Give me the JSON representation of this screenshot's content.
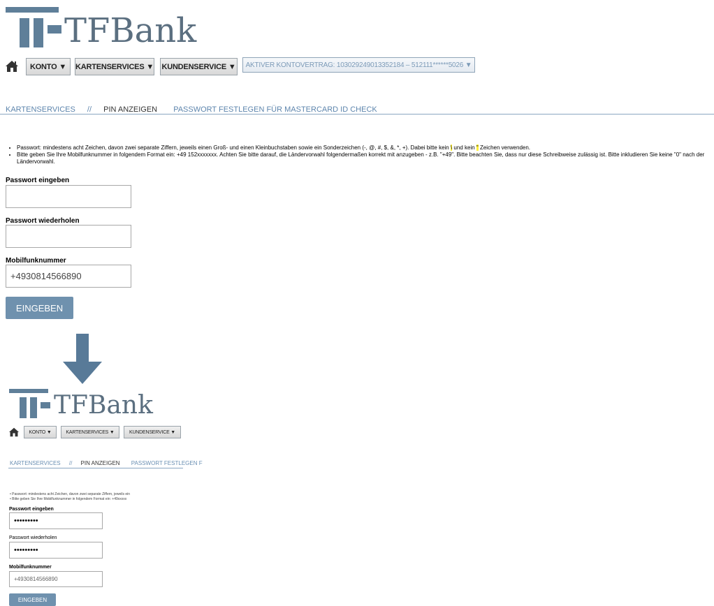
{
  "brand": {
    "name": "TFBank"
  },
  "nav": {
    "home_icon": "home-icon",
    "items": [
      {
        "label": "KONTO ▼"
      },
      {
        "label": "KARTENSERVICES ▼"
      },
      {
        "label": "KUNDENSERVICE ▼"
      }
    ],
    "contract": "AKTIVER KONTOVERTRAG: 103029249013352184 – 512111******5026 ▼"
  },
  "breadcrumb": {
    "items": [
      "KARTENSERVICES",
      "//",
      "PIN ANZEIGEN",
      "PASSWORT FESTLEGEN FÜR MASTERCARD ID CHECK"
    ]
  },
  "info": {
    "bullet1_a": "Passwort: mindestens acht Zeichen, davon zwei separate Ziffern, jeweils einen Groß- und einen Kleinbuchstaben sowie ein Sonderzeichen (-, @, #, $, &, *, +). Dabei bitte kein ",
    "bullet1_hl1": "\\",
    "bullet1_b": " und kein ",
    "bullet1_hl2": "\"",
    "bullet1_c": " Zeichen verwenden.",
    "bullet2": "Bitte geben Sie Ihre Mobilfunknummer in folgendem Format ein: +49 152xxxxxxx. Achten Sie bitte darauf, die Ländervorwahl folgendermaßen korrekt mit anzugeben - z.B. \"+49\". Bitte beachten Sie, dass nur diese Schreibweise zulässig ist. Bitte inkludieren Sie keine \"0\" nach der Ländervorwahl."
  },
  "form": {
    "password_label": "Passwort eingeben",
    "password_value": "",
    "repeat_label": "Passwort wiederholen",
    "repeat_value": "",
    "mobile_label": "Mobilfunknummer",
    "mobile_value": "+4930814566890",
    "submit_label": "EINGEBEN"
  },
  "after": {
    "password_value": "•••••••••",
    "repeat_value": "•••••••••",
    "mobile_value": "+4930814566890",
    "breadcrumb_last": "PASSWORT FESTLEGEN F",
    "bullet1_cut": "Passwort: mindestens acht Zeichen, davon zwei separate Ziffern, jeweils ein",
    "bullet2_cut": "Bitte geben Sie Ihre Mobilfunknummer in folgendem Format ein: +49xxxxx"
  },
  "colors": {
    "brand": "#5f7f99",
    "button": "#6f91ae",
    "link": "#5d85ad",
    "highlight": "#ffef3a"
  }
}
